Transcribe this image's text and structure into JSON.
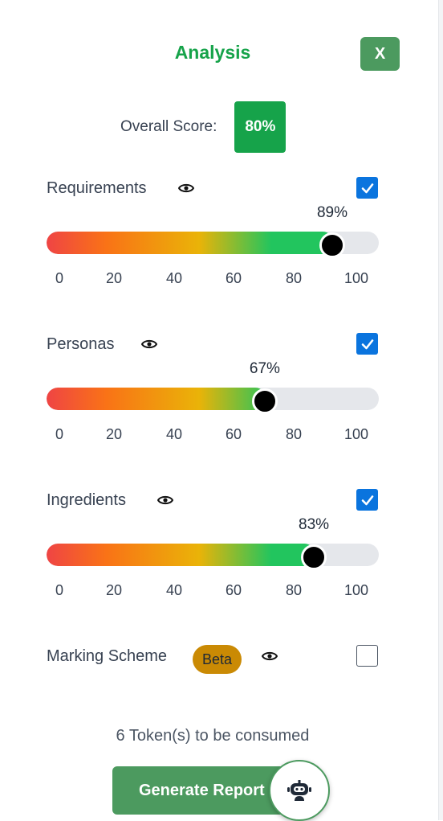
{
  "header": {
    "title": "Analysis",
    "close_label": "X"
  },
  "overall": {
    "label": "Overall Score:",
    "value": "80%"
  },
  "scale_ticks": [
    "0",
    "20",
    "40",
    "60",
    "80",
    "100"
  ],
  "sections": [
    {
      "label": "Requirements",
      "percent_label": "89%",
      "value": 89,
      "checked": true,
      "eye_icon": "eye-icon"
    },
    {
      "label": "Personas",
      "percent_label": "67%",
      "value": 67,
      "checked": true,
      "eye_icon": "eye-icon"
    },
    {
      "label": "Ingredients",
      "percent_label": "83%",
      "value": 83,
      "checked": true,
      "eye_icon": "eye-icon"
    }
  ],
  "marking_scheme": {
    "label": "Marking Scheme",
    "badge": "Beta",
    "checked": false,
    "eye_icon": "eye-icon"
  },
  "footer": {
    "tokens_text": "6 Token(s) to be consumed",
    "generate_label": "Generate Report",
    "chat_icon": "robot-icon"
  },
  "colors": {
    "accent": "#16a34a",
    "button": "#4c9a5f",
    "checkbox": "#0a74de",
    "beta": "#ca8a04"
  }
}
